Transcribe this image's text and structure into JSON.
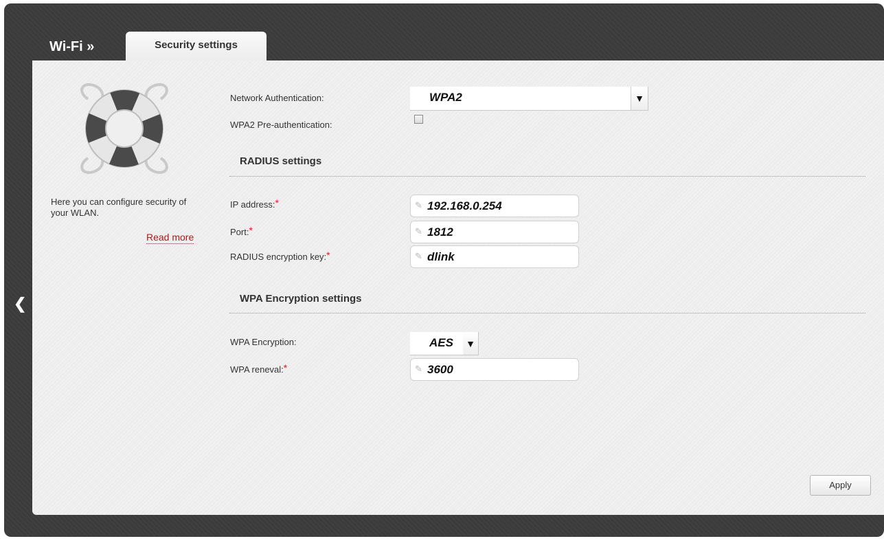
{
  "header": {
    "breadcrumb": "Wi-Fi »",
    "tab_label": "Security settings"
  },
  "sidebar": {
    "help_text": "Here you can configure security of your WLAN.",
    "read_more": "Read more",
    "back_icon": "chevron-left-icon",
    "illustration_icon": "lifebuoy-icon"
  },
  "form": {
    "network_auth": {
      "label": "Network Authentication:",
      "value": "WPA2"
    },
    "preauth": {
      "label": "WPA2 Pre-authentication:",
      "checked": false
    },
    "radius_section": {
      "title": "RADIUS settings",
      "ip": {
        "label": "IP address:",
        "required": "*",
        "value": "192.168.0.254"
      },
      "port": {
        "label": "Port:",
        "required": "*",
        "value": "1812"
      },
      "key": {
        "label": "RADIUS encryption key:",
        "required": "*",
        "value": "dlink"
      }
    },
    "wpa_section": {
      "title": "WPA Encryption settings",
      "encryption": {
        "label": "WPA Encryption:",
        "value": "AES"
      },
      "renewal": {
        "label": "WPA reneval:",
        "required": "*",
        "value": "3600"
      }
    }
  },
  "actions": {
    "apply_label": "Apply"
  },
  "colors": {
    "frame": "#3b3b3b",
    "panel": "#ededed",
    "required": "#e01818",
    "link": "#b01919"
  }
}
